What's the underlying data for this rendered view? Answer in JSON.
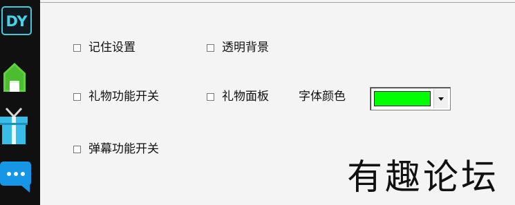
{
  "sidebar": {
    "logo_text": "DY",
    "icons": [
      {
        "name": "home-icon"
      },
      {
        "name": "gift-icon"
      },
      {
        "name": "chat-bubble-icon"
      }
    ],
    "colors": {
      "background": "#101010",
      "logo_border": "#46c8d8",
      "home_green": "#5ed23f",
      "gift_blue": "#37bde8",
      "chat_blue": "#1596e6"
    }
  },
  "settings": {
    "remember_settings": {
      "label": "记住设置",
      "checked": false
    },
    "transparent_background": {
      "label": "透明背景",
      "checked": false
    },
    "gift_feature_toggle": {
      "label": "礼物功能开关",
      "checked": false
    },
    "gift_panel": {
      "label": "礼物面板",
      "checked": false
    },
    "font_color_label": "字体颜色",
    "font_color_value": "#00ff00",
    "danmaku_feature_toggle": {
      "label": "弹幕功能开关",
      "checked": false
    }
  },
  "watermark": {
    "text": "有趣论坛"
  }
}
